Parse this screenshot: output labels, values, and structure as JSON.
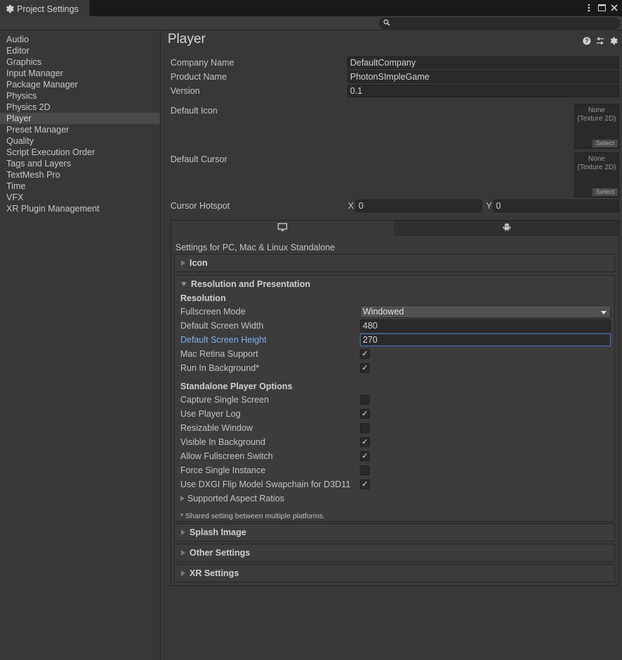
{
  "window": {
    "tab_title": "Project Settings",
    "search_placeholder": ""
  },
  "sidebar": {
    "items": [
      {
        "label": "Audio"
      },
      {
        "label": "Editor"
      },
      {
        "label": "Graphics"
      },
      {
        "label": "Input Manager"
      },
      {
        "label": "Package Manager"
      },
      {
        "label": "Physics"
      },
      {
        "label": "Physics 2D"
      },
      {
        "label": "Player",
        "selected": true
      },
      {
        "label": "Preset Manager"
      },
      {
        "label": "Quality"
      },
      {
        "label": "Script Execution Order"
      },
      {
        "label": "Tags and Layers"
      },
      {
        "label": "TextMesh Pro"
      },
      {
        "label": "Time"
      },
      {
        "label": "VFX"
      },
      {
        "label": "XR Plugin Management"
      }
    ]
  },
  "player": {
    "title": "Player",
    "company_label": "Company Name",
    "company_value": "DefaultCompany",
    "product_label": "Product Name",
    "product_value": "PhotonSImpleGame",
    "version_label": "Version",
    "version_value": "0.1",
    "default_icon_label": "Default Icon",
    "default_icon_none": "None",
    "default_icon_type": "(Texture 2D)",
    "default_icon_select": "Select",
    "default_cursor_label": "Default Cursor",
    "default_cursor_none": "None",
    "default_cursor_type": "(Texture 2D)",
    "default_cursor_select": "Select",
    "hotspot_label": "Cursor Hotspot",
    "hotspot_x_label": "X",
    "hotspot_x_value": "0",
    "hotspot_y_label": "Y",
    "hotspot_y_value": "0"
  },
  "platform": {
    "tabs": [
      {
        "icon": "monitor-icon",
        "active": true
      },
      {
        "icon": "android-icon",
        "active": false
      }
    ],
    "caption": "Settings for PC, Mac & Linux Standalone",
    "sections": {
      "icon": "Icon",
      "resolution": "Resolution and Presentation",
      "splash": "Splash Image",
      "other": "Other Settings",
      "xr": "XR Settings"
    },
    "resolution": {
      "heading": "Resolution",
      "fullscreen_label": "Fullscreen Mode",
      "fullscreen_value": "Windowed",
      "width_label": "Default Screen Width",
      "width_value": "480",
      "height_label": "Default Screen Height",
      "height_value": "270",
      "retina_label": "Mac Retina Support",
      "retina_checked": true,
      "background_label": "Run In Background*",
      "background_checked": true
    },
    "standalone": {
      "heading": "Standalone Player Options",
      "options": [
        {
          "label": "Capture Single Screen",
          "checked": false
        },
        {
          "label": "Use Player Log",
          "checked": true
        },
        {
          "label": "Resizable Window",
          "checked": false
        },
        {
          "label": "Visible In Background",
          "checked": true
        },
        {
          "label": "Allow Fullscreen Switch",
          "checked": true
        },
        {
          "label": "Force Single Instance",
          "checked": false
        },
        {
          "label": "Use DXGI Flip Model Swapchain for D3D11",
          "checked": true
        }
      ],
      "aspect_label": "Supported Aspect Ratios",
      "note": "* Shared setting between multiple platforms."
    }
  }
}
